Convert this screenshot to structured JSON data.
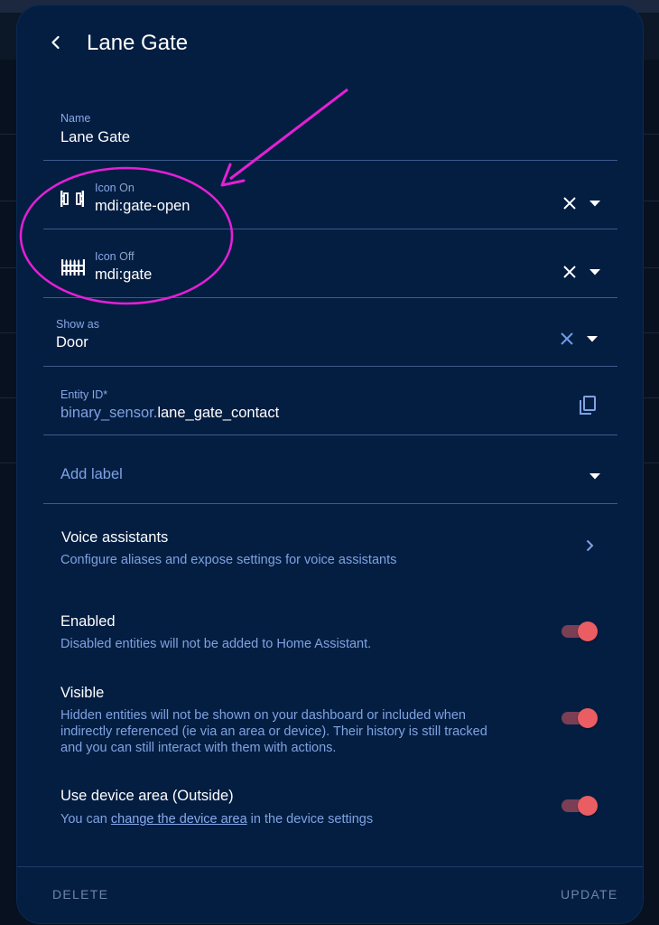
{
  "dialog": {
    "title": "Lane Gate",
    "back_icon": "chevron-left-icon"
  },
  "fields": {
    "name": {
      "label": "Name",
      "value": "Lane Gate"
    },
    "icon_on": {
      "label_main": "Icon",
      "label_sub": "On",
      "value": "mdi:gate-open",
      "icon": "gate-open-icon"
    },
    "icon_off": {
      "label_main": "Icon",
      "label_sub": "Off",
      "value": "mdi:gate",
      "icon": "gate-icon"
    },
    "show_as": {
      "label": "Show as",
      "value": "Door"
    },
    "entity_id": {
      "label": "Entity ID*",
      "domain": "binary_sensor.",
      "object_id": "lane_gate_contact"
    },
    "add_label": {
      "label": "Add label"
    }
  },
  "voice": {
    "title": "Voice assistants",
    "description": "Configure aliases and expose settings for voice assistants"
  },
  "enabled": {
    "title": "Enabled",
    "description": "Disabled entities will not be added to Home Assistant.",
    "on": true
  },
  "visible": {
    "title": "Visible",
    "description_1": "Hidden entities will not be shown on your dashboard or included when",
    "description_2": "indirectly referenced (ie via an area or device). Their history is still tracked",
    "description_3": "and you can still interact with them with actions.",
    "on": true
  },
  "device_area": {
    "title": "Use device area (Outside)",
    "desc_prefix": "You can ",
    "desc_link": "change the device area",
    "desc_suffix": " in the device settings",
    "on": true
  },
  "footer": {
    "delete_label": "DELETE",
    "update_label": "UPDATE"
  },
  "colors": {
    "dialog_bg": "#041e42",
    "accent": "#87a8e6",
    "toggle_on": "#e95d63",
    "annotation": "#e51fd6"
  }
}
